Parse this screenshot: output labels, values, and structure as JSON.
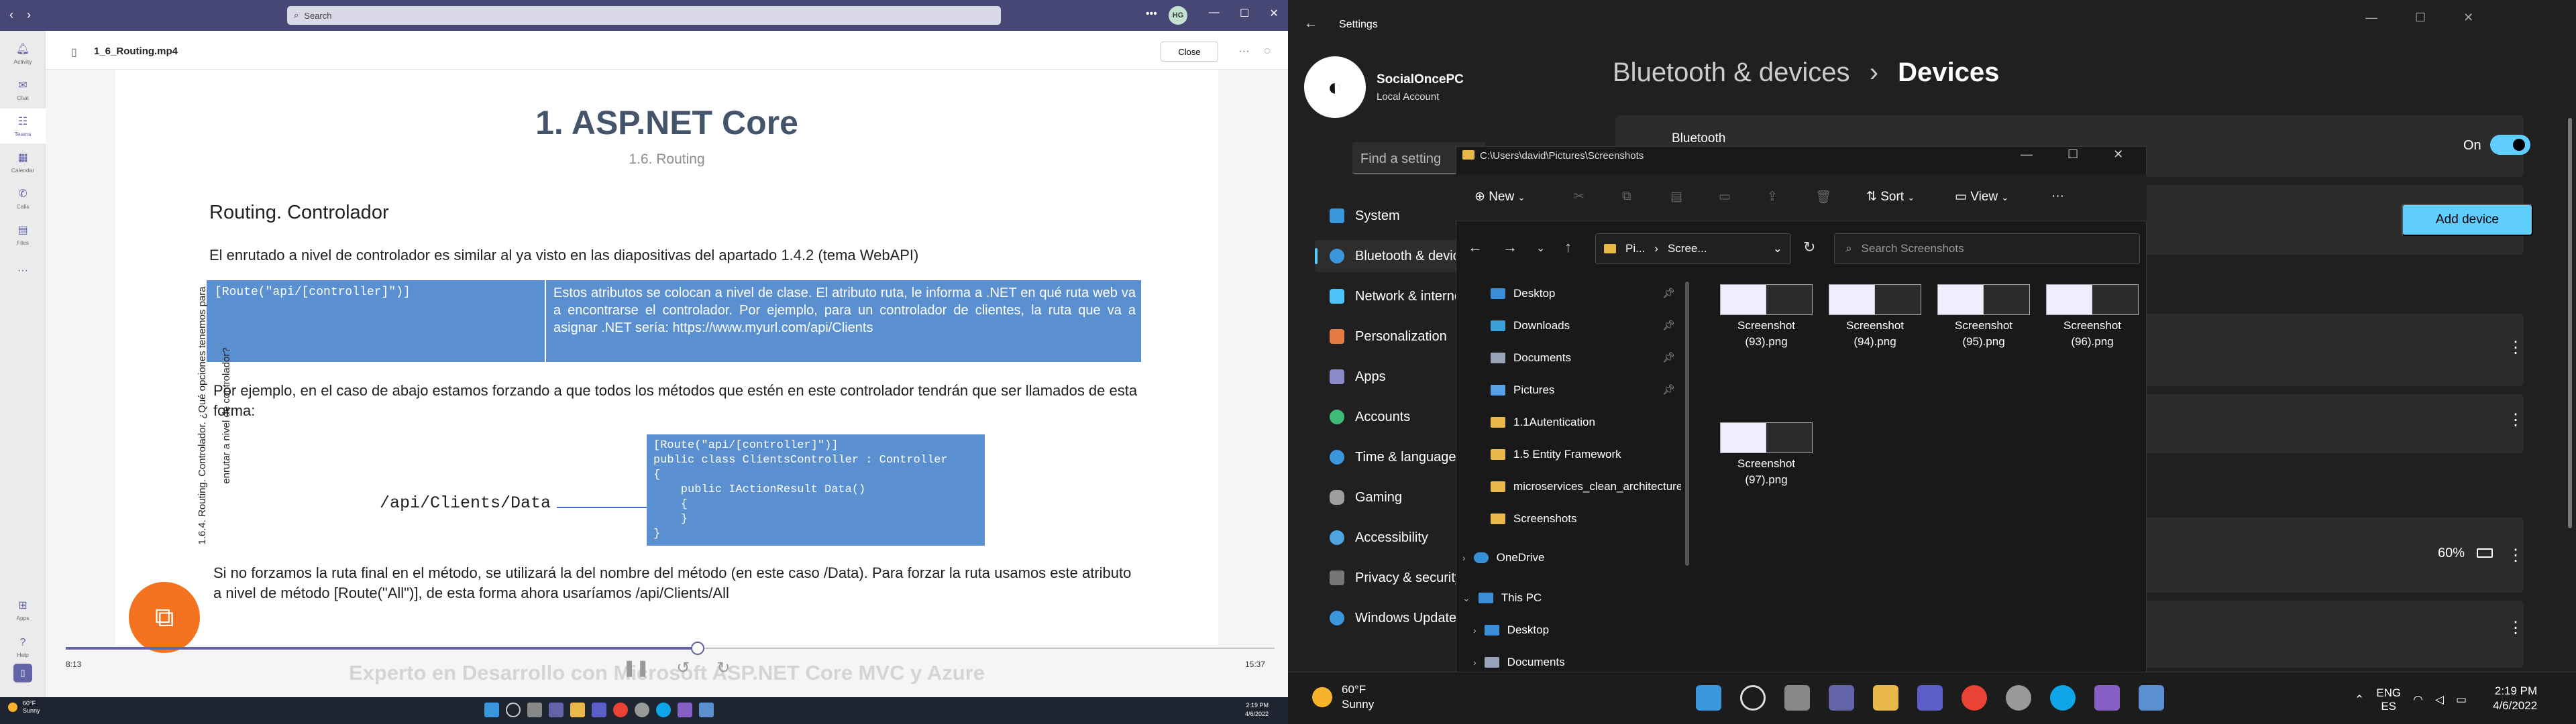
{
  "teams": {
    "search_placeholder": "Search",
    "avatar_initials": "HG",
    "file_name": "1_6_Routing.mp4",
    "close_label": "Close",
    "rail": [
      {
        "label": "Activity",
        "icon": "bell-icon"
      },
      {
        "label": "Chat",
        "icon": "chat-icon"
      },
      {
        "label": "Teams",
        "icon": "teams-icon"
      },
      {
        "label": "Calendar",
        "icon": "calendar-icon"
      },
      {
        "label": "Calls",
        "icon": "phone-icon"
      },
      {
        "label": "Files",
        "icon": "file-icon"
      },
      {
        "label": "Apps",
        "icon": "apps-icon"
      },
      {
        "label": "Help",
        "icon": "help-icon"
      }
    ],
    "current_time": "8:13",
    "duration": "15:37",
    "progress": 0.523,
    "slide": {
      "title": "1. ASP.NET Core",
      "subtitle": "1.6. Routing",
      "heading": "Routing. Controlador",
      "para1": "El enrutado a nivel de controlador es similar al ya visto en las diapositivas del apartado 1.4.2 (tema WebAPI)",
      "table_code": "[Route(\"api/[controller]\")]",
      "table_text": "Estos atributos se colocan a nivel de clase. El atributo ruta, le informa a .NET en qué ruta web va a encontrarse el controlador. Por ejemplo, para un controlador de clientes, la ruta que va a asignar .NET sería: https://www.myurl.com/api/Clients",
      "para2": "Por ejemplo, en el caso de abajo estamos forzando a que todos los métodos que estén en este controlador tendrán que ser llamados de esta forma:",
      "api_path": "/api/Clients/Data",
      "code": "[Route(\"api/[controller]\")]\npublic class ClientsController : Controller\n{\n    public IActionResult Data()\n    {\n    }\n}",
      "para3": "Si no forzamos la ruta final en el método, se utilizará la del nombre del método (en este caso /Data). Para forzar la ruta usamos este atributo a nivel de método [Route(\"All\")], de esta forma ahora usaríamos /api/Clients/All",
      "side_text": "1.6.4. Routing. Controlador. ¿Qué opciones tenemos para enrutar a nivel de controlador?",
      "footer": "Experto en Desarrollo con Microsoft ASP.NET Core MVC y Azure"
    },
    "taskbar": {
      "weather_temp": "60°F",
      "weather_desc": "Sunny",
      "time": "2:19 PM",
      "date": "4/6/2022"
    }
  },
  "settings": {
    "window_title": "Settings",
    "user_name": "SocialOncePC",
    "account_type": "Local Account",
    "search_placeholder": "Find a setting",
    "nav": [
      {
        "label": "System",
        "color": "#3a96dd"
      },
      {
        "label": "Bluetooth & devices",
        "color": "#3a96dd"
      },
      {
        "label": "Network & internet",
        "color": "#4fc3f7"
      },
      {
        "label": "Personalization",
        "color": "#e57a44"
      },
      {
        "label": "Apps",
        "color": "#8a8ac8"
      },
      {
        "label": "Accounts",
        "color": "#3dbb77"
      },
      {
        "label": "Time & language",
        "color": "#3a96dd"
      },
      {
        "label": "Gaming",
        "color": "#9e9e9e"
      },
      {
        "label": "Accessibility",
        "color": "#4fa3e0"
      },
      {
        "label": "Privacy & security",
        "color": "#777"
      },
      {
        "label": "Windows Update",
        "color": "#3a96dd"
      }
    ],
    "breadcrumb_parent": "Bluetooth & devices",
    "breadcrumb_current": "Devices",
    "bluetooth_label": "Bluetooth",
    "bluetooth_state": "On",
    "add_device": "Add device",
    "battery": "60%",
    "accent": "#60cdff"
  },
  "explorer": {
    "title_path": "C:\\Users\\david\\Pictures\\Screenshots",
    "new_label": "New",
    "sort_label": "Sort",
    "view_label": "View",
    "address": [
      "Pi...",
      "Scree..."
    ],
    "search_placeholder": "Search Screenshots",
    "tree": [
      {
        "label": "Desktop",
        "pinned": true,
        "color": "#3a8fd8"
      },
      {
        "label": "Downloads",
        "pinned": true,
        "color": "#3aa0d8"
      },
      {
        "label": "Documents",
        "pinned": true,
        "color": "#9aa4b8"
      },
      {
        "label": "Pictures",
        "pinned": true,
        "color": "#5aa0e8"
      },
      {
        "label": "1.1Autentication",
        "pinned": false,
        "color": "#e8b84a"
      },
      {
        "label": "1.5 Entity Framework",
        "pinned": false,
        "color": "#e8b84a"
      },
      {
        "label": "microservices_clean_architecture",
        "pinned": false,
        "color": "#e8b84a"
      },
      {
        "label": "Screenshots",
        "pinned": false,
        "color": "#e8b84a"
      },
      {
        "label": "OneDrive",
        "pinned": false,
        "color": "#3a8fd8"
      },
      {
        "label": "This PC",
        "pinned": false,
        "color": "#3a8fd8"
      },
      {
        "label": "Desktop",
        "pinned": false,
        "color": "#3a8fd8"
      },
      {
        "label": "Documents",
        "pinned": false,
        "color": "#9aa4b8"
      }
    ],
    "files": [
      {
        "name": "Screenshot (93).png"
      },
      {
        "name": "Screenshot (94).png"
      },
      {
        "name": "Screenshot (95).png"
      },
      {
        "name": "Screenshot (96).png"
      },
      {
        "name": "Screenshot (97).png"
      }
    ]
  },
  "taskbar2": {
    "weather_temp": "60°F",
    "weather_desc": "Sunny",
    "lang": "ENG",
    "region": "ES",
    "time": "2:19 PM",
    "date": "4/6/2022"
  }
}
